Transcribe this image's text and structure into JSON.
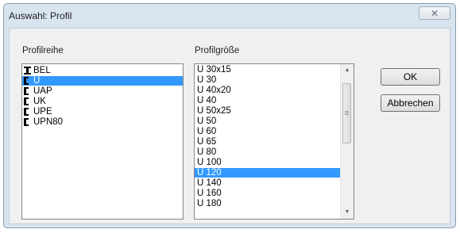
{
  "window": {
    "title": "Auswahl: Profil",
    "close_glyph": "✕"
  },
  "profilreihe": {
    "label": "Profilreihe",
    "items": [
      {
        "label": "BEL",
        "icon": "i-beam-icon",
        "selected": false
      },
      {
        "label": "U",
        "icon": "channel-icon",
        "selected": true
      },
      {
        "label": "UAP",
        "icon": "channel-icon",
        "selected": false
      },
      {
        "label": "UK",
        "icon": "channel-icon",
        "selected": false
      },
      {
        "label": "UPE",
        "icon": "channel-icon",
        "selected": false
      },
      {
        "label": "UPN80",
        "icon": "channel-icon",
        "selected": false
      }
    ]
  },
  "profilgroesse": {
    "label": "Profilgröße",
    "items": [
      "U 30x15",
      "U 30",
      "U 40x20",
      "U 40",
      "U 50x25",
      "U 50",
      "U 60",
      "U 65",
      "U 80",
      "U 100",
      "U 120",
      "U 140",
      "U 160",
      "U 180"
    ],
    "selected_index": 10,
    "scroll_up_glyph": "▲",
    "scroll_down_glyph": "▼"
  },
  "buttons": {
    "ok": "OK",
    "cancel": "Abbrechen"
  },
  "colors": {
    "selection": "#3399ff",
    "frame": "#d9e4f1"
  }
}
